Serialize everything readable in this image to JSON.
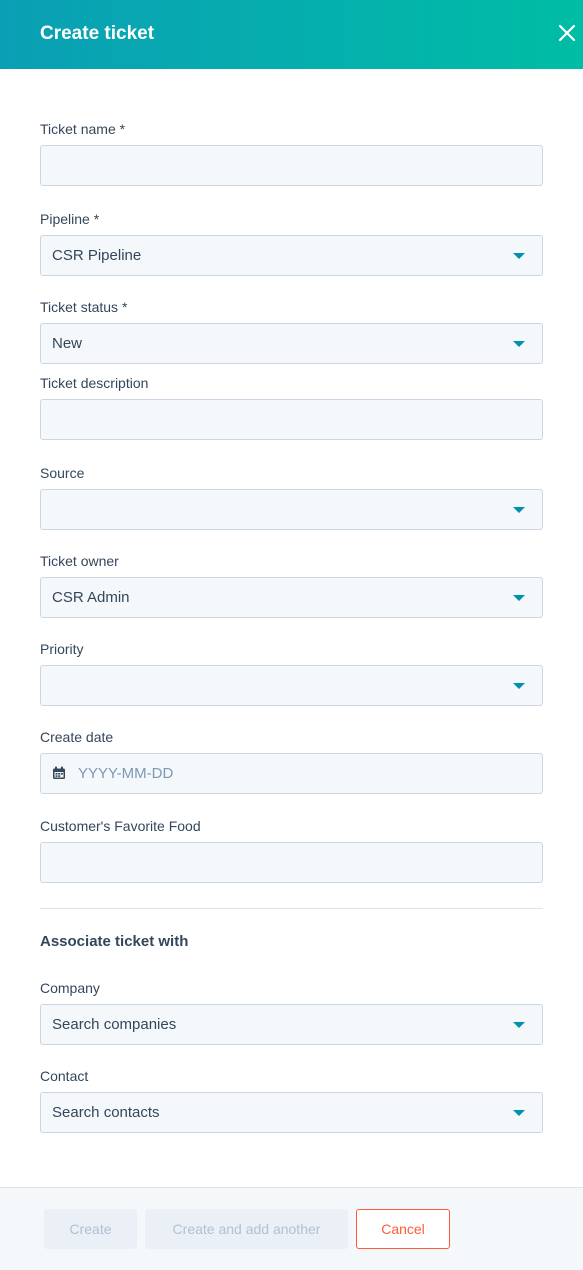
{
  "header": {
    "title": "Create ticket"
  },
  "fields": [
    {
      "label": "Ticket name *",
      "value": ""
    },
    {
      "label": "Pipeline *",
      "value": "CSR Pipeline"
    },
    {
      "label": "Ticket status *",
      "value": "New"
    },
    {
      "label": "Ticket description",
      "value": ""
    },
    {
      "label": "Source",
      "value": ""
    },
    {
      "label": "Ticket owner",
      "value": "CSR Admin"
    },
    {
      "label": "Priority",
      "value": ""
    },
    {
      "label": "Create date",
      "placeholder": "YYYY-MM-DD"
    },
    {
      "label": "Customer's Favorite Food",
      "value": ""
    }
  ],
  "associate": {
    "title": "Associate ticket with",
    "company": {
      "label": "Company",
      "placeholder": "Search companies"
    },
    "contact": {
      "label": "Contact",
      "placeholder": "Search contacts"
    }
  },
  "footer": {
    "create_label": "Create",
    "create_another_label": "Create and add another",
    "cancel_label": "Cancel"
  },
  "colors": {
    "header_gradient_start": "#0a9fb5",
    "header_gradient_end": "#00bda5",
    "caret": "#0091ae",
    "cancel": "#ff5c35"
  },
  "icons": {
    "close": "close-icon",
    "dropdown": "caret-down-icon",
    "calendar": "calendar-icon"
  }
}
